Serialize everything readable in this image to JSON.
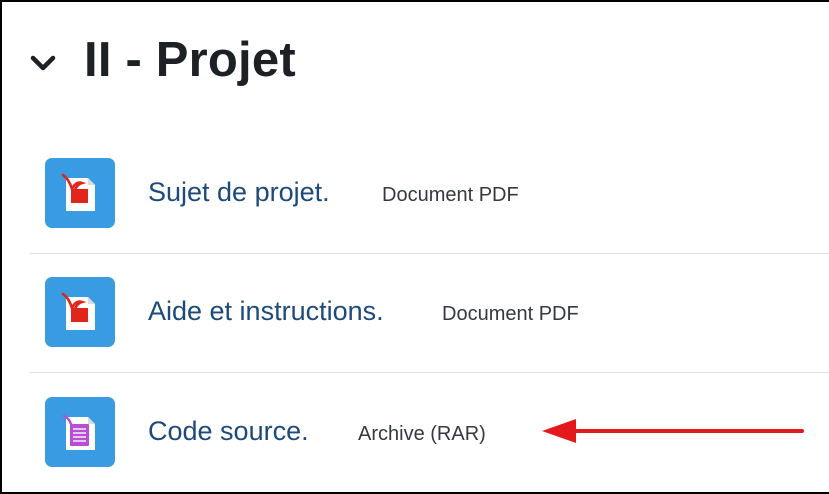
{
  "section": {
    "title": "II - Projet",
    "toggle_icon": "chevron-down-icon"
  },
  "activities": [
    {
      "name": "Sujet de projet.",
      "type": "Document PDF",
      "icon": "pdf-file-icon"
    },
    {
      "name": "Aide et instructions.",
      "type": "Document PDF",
      "icon": "pdf-file-icon"
    },
    {
      "name": "Code source.",
      "type": "Archive (RAR)",
      "icon": "archive-file-icon"
    }
  ],
  "annotation": {
    "icon": "red-arrow-icon",
    "color": "#e3191c"
  },
  "colors": {
    "icon_background": "#399be2",
    "link": "#1d4a7a",
    "pdf_red": "#e1251b",
    "archive_purple": "#b64fd2"
  }
}
